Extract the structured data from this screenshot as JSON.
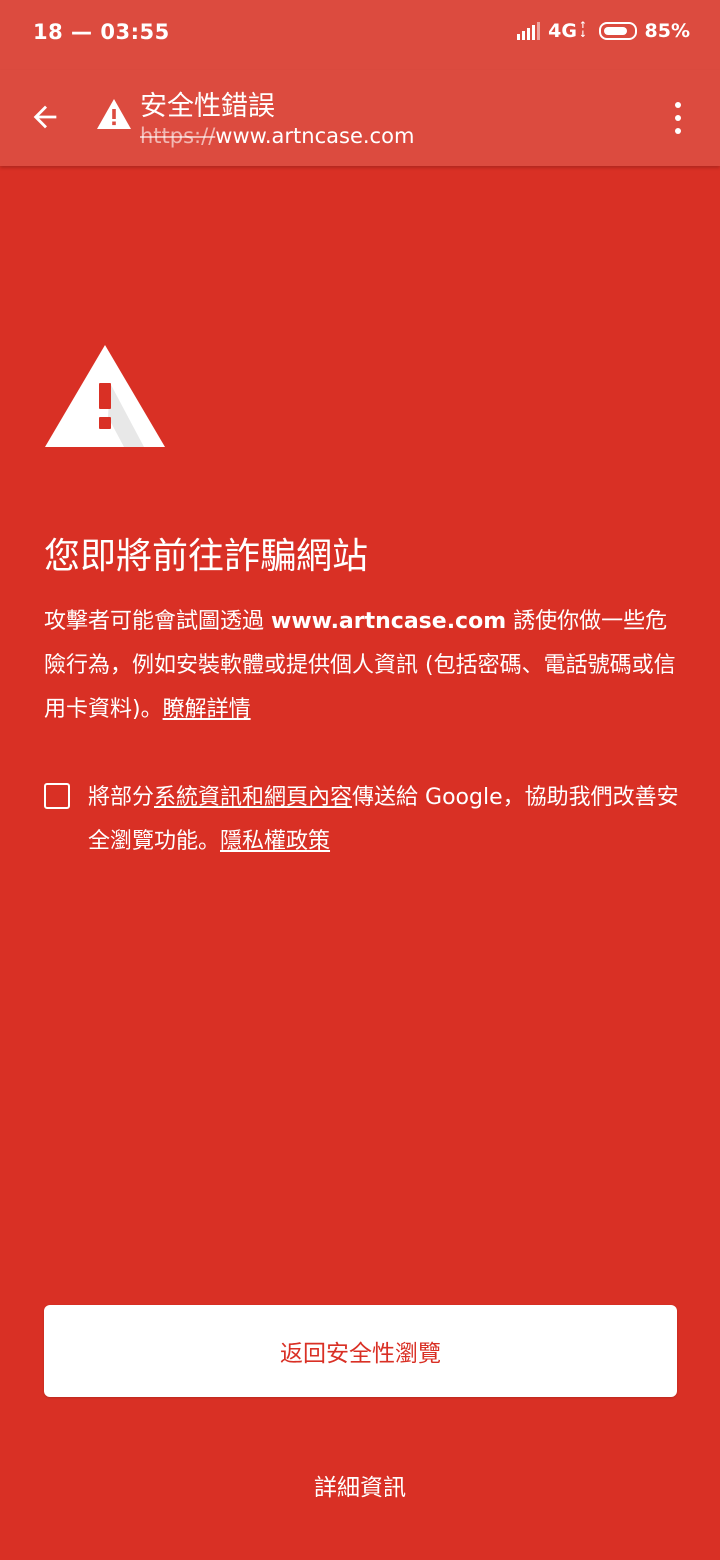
{
  "status_bar": {
    "time": "18 — 03:55",
    "network": "4G",
    "battery_level": 0.85,
    "battery": "85%"
  },
  "toolbar": {
    "back_icon": "arrow-left-icon",
    "warning_icon": "warning-triangle-icon",
    "title": "安全性錯誤",
    "url_scheme": "https://",
    "url_host": "www.artncase.com",
    "menu_icon": "more-vert-icon"
  },
  "interstitial": {
    "icon": "warning-triangle-icon",
    "headline": "您即將前往詐騙網站",
    "body_prefix": "攻擊者可能會試圖透過 ",
    "body_site": "www.artncase.com",
    "body_suffix": " 誘使你做一些危險行為，例如安裝軟體或提供個人資訊 (包括密碼、電話號碼或信用卡資料)。",
    "learn_more_link": "瞭解詳情",
    "optin_checked": false,
    "optin_prefix": "將部分",
    "optin_link": "系統資訊和網頁內容",
    "optin_suffix": "傳送給 Google，協助我們改善安全瀏覽功能。",
    "privacy_link": "隱私權政策",
    "primary_button": "返回安全性瀏覽",
    "details_button": "詳細資訊"
  },
  "colors": {
    "background": "#d93025",
    "toolbar": "#dc4b3f",
    "text": "#ffffff",
    "button_text": "#d93025"
  }
}
